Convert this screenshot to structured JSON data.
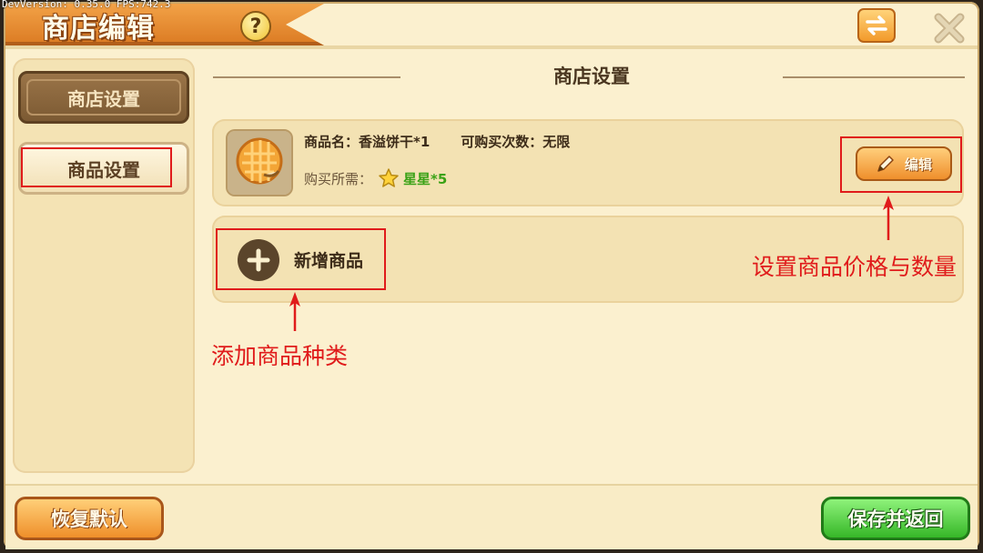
{
  "debug": {
    "text": "DevVersion: 0.35.0     FPS:742.3"
  },
  "header": {
    "title": "商店编辑",
    "help_icon": "question-mark",
    "swap_icon": "swap-arrows",
    "close_icon": "close-x"
  },
  "sidebar": {
    "items": [
      {
        "label": "商店设置",
        "active": true
      },
      {
        "label": "商品设置",
        "active": false
      }
    ]
  },
  "main": {
    "section_title": "商店设置",
    "goods": [
      {
        "name_label": "商品名：香溢饼干*1",
        "limit_label": "可购买次数：无限",
        "cost_label": "购买所需：",
        "cost_item": "星星*5",
        "edit_label": "编辑"
      }
    ],
    "add_label": "新增商品"
  },
  "annotations": {
    "edit_hint": "设置商品价格与数量",
    "add_hint": "添加商品种类"
  },
  "footer": {
    "restore_label": "恢复默认",
    "save_label": "保存并返回"
  },
  "colors": {
    "highlight": "#e01b1b",
    "accent_orange": "#ef8f2c",
    "save_green": "#36b728"
  }
}
